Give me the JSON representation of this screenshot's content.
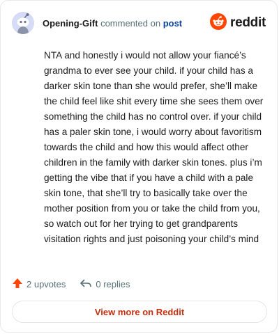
{
  "header": {
    "author": "Opening-Gift",
    "action_text": "commented on",
    "post_link": "post",
    "brand": "reddit",
    "avatar_icon": "snoo-avatar-icon",
    "brand_icon": "reddit-logo-icon"
  },
  "comment": {
    "body": "NTA and honestly i would not allow your fiancé’s grandma to ever see your child. if your child has a darker skin tone than she would prefer, she’ll make the child feel like shit every time she sees them over something the child has no control over. if your child has a paler skin tone, i would worry about favoritism towards the child and how this would affect other children in the family with darker skin tones. plus i’m getting the vibe that if you have a child with a pale skin tone, that she’ll try to basically take over the mother position from you or take the child from you, so watch out for her trying to get grandparents visitation rights and just poisoning your child’s mind"
  },
  "actions": {
    "upvotes": "2 upvotes",
    "replies": "0 replies",
    "upvote_icon": "upvote-arrow-icon",
    "reply_icon": "reply-arrow-icon"
  },
  "footer": {
    "view_more": "View more on Reddit"
  },
  "colors": {
    "brand_orange": "#ff4500",
    "link_blue": "#0a449b",
    "view_more_red": "#c4300f",
    "meta_gray": "#576f76"
  }
}
